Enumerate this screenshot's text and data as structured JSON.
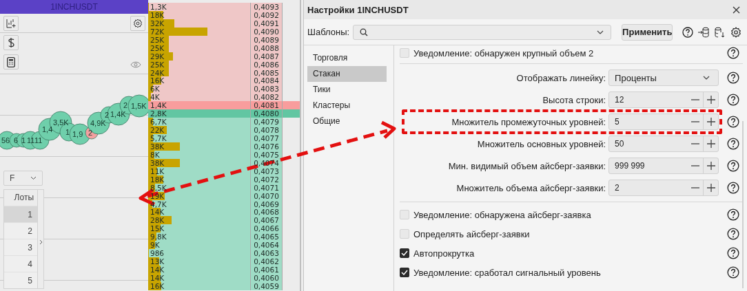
{
  "left_panel": {
    "header": "1INCHUSDT",
    "bubbles": [
      {
        "label": "56",
        "color": "#6fcfab"
      },
      {
        "label": "6",
        "color": "#6fcfab"
      },
      {
        "label": "1",
        "color": "#6fcfab"
      },
      {
        "label": "11",
        "color": "#6fcfab"
      },
      {
        "label": "11",
        "color": "#6fcfab"
      },
      {
        "label": "1,4",
        "color": "#6fcfab"
      },
      {
        "label": "3,5K",
        "color": "#6fcfab"
      },
      {
        "label": "1",
        "color": "#6fcfab"
      },
      {
        "label": "1,9",
        "color": "#6fcfab"
      },
      {
        "label": "2",
        "color": "#f4a0a0"
      },
      {
        "label": "4,9K",
        "color": "#6fcfab"
      },
      {
        "label": "2",
        "color": "#6fcfab"
      },
      {
        "label": "1,4K",
        "color": "#6fcfab"
      },
      {
        "label": "2",
        "color": "#6fcfab"
      },
      {
        "label": "1,5K",
        "color": "#6fcfab"
      }
    ],
    "dropdown": {
      "value": "F"
    },
    "lots_table": {
      "header": "Лоты",
      "rows": [
        {
          "value": "1",
          "selected": true
        },
        {
          "value": "2",
          "selected": false
        },
        {
          "value": "3",
          "selected": false
        },
        {
          "value": "4",
          "selected": false
        },
        {
          "value": "5",
          "selected": false
        }
      ]
    }
  },
  "order_book": [
    {
      "kind": "ask",
      "volume": "1,3K",
      "price": "0,4093",
      "level": 0.01
    },
    {
      "kind": "ask",
      "volume": "18K",
      "price": "0,4092",
      "level": 0.15
    },
    {
      "kind": "ask",
      "volume": "32K",
      "price": "0,4091",
      "level": 0.26
    },
    {
      "kind": "ask",
      "volume": "72K",
      "price": "0,4090",
      "level": 0.58
    },
    {
      "kind": "ask",
      "volume": "25K",
      "price": "0,4089",
      "level": 0.2
    },
    {
      "kind": "ask",
      "volume": "25K",
      "price": "0,4088",
      "level": 0.2
    },
    {
      "kind": "ask",
      "volume": "29K",
      "price": "0,4087",
      "level": 0.24
    },
    {
      "kind": "ask",
      "volume": "25K",
      "price": "0,4086",
      "level": 0.2
    },
    {
      "kind": "ask",
      "volume": "24K",
      "price": "0,4085",
      "level": 0.2
    },
    {
      "kind": "ask",
      "volume": "16K",
      "price": "0,4084",
      "level": 0.13
    },
    {
      "kind": "ask",
      "volume": "6K",
      "price": "0,4083",
      "level": 0.05
    },
    {
      "kind": "ask",
      "volume": "4K",
      "price": "0,4082",
      "level": 0.03
    },
    {
      "kind": "best_ask",
      "volume": "1,4K",
      "price": "0,4081"
    },
    {
      "kind": "best_bid",
      "volume": "2,8K",
      "price": "0,4080"
    },
    {
      "kind": "bid",
      "volume": "6,7K",
      "price": "0,4079",
      "level": 0.05
    },
    {
      "kind": "bid",
      "volume": "22K",
      "price": "0,4078",
      "level": 0.18
    },
    {
      "kind": "bid",
      "volume": "5,7K",
      "price": "0,4077",
      "level": 0.05
    },
    {
      "kind": "bid",
      "volume": "38K",
      "price": "0,4076",
      "level": 0.31
    },
    {
      "kind": "bid",
      "volume": "8K",
      "price": "0,4075",
      "level": 0.06
    },
    {
      "kind": "bid",
      "volume": "38K",
      "price": "0,4074",
      "level": 0.31
    },
    {
      "kind": "bid",
      "volume": "11K",
      "price": "0,4073",
      "level": 0.09
    },
    {
      "kind": "bid",
      "volume": "18K",
      "price": "0,4072",
      "level": 0.15
    },
    {
      "kind": "bid",
      "volume": "8,5K",
      "price": "0,4071",
      "level": 0.07
    },
    {
      "kind": "bid",
      "volume": "19K",
      "price": "0,4070",
      "level": 0.16
    },
    {
      "kind": "bid",
      "volume": "4,7K",
      "price": "0,4069",
      "level": 0.04
    },
    {
      "kind": "bid",
      "volume": "14K",
      "price": "0,4068",
      "level": 0.12
    },
    {
      "kind": "bid",
      "volume": "28K",
      "price": "0,4067",
      "level": 0.23
    },
    {
      "kind": "bid",
      "volume": "15K",
      "price": "0,4066",
      "level": 0.12
    },
    {
      "kind": "bid",
      "volume": "9,8K",
      "price": "0,4065",
      "level": 0.08
    },
    {
      "kind": "bid",
      "volume": "9K",
      "price": "0,4064",
      "level": 0.07
    },
    {
      "kind": "bid",
      "volume": "986",
      "price": "0,4063",
      "level": 0.01
    },
    {
      "kind": "bid",
      "volume": "13K",
      "price": "0,4062",
      "level": 0.11
    },
    {
      "kind": "bid",
      "volume": "14K",
      "price": "0,4061",
      "level": 0.12
    },
    {
      "kind": "bid",
      "volume": "14K",
      "price": "0,4060",
      "level": 0.12
    },
    {
      "kind": "bid",
      "volume": "16K",
      "price": "0,4059",
      "level": 0.13
    }
  ],
  "settings_dialog": {
    "title": "Настройки 1INCHUSDT",
    "templates_label": "Шаблоны:",
    "apply_button": "Применить",
    "nav": [
      {
        "label": "Торговля",
        "selected": false
      },
      {
        "label": "Стакан",
        "selected": true
      },
      {
        "label": "Тики",
        "selected": false
      },
      {
        "label": "Кластеры",
        "selected": false
      },
      {
        "label": "Общие",
        "selected": false
      }
    ],
    "top_option": {
      "label": "Уведомление: обнаружен крупный объем 2",
      "checked": false
    },
    "fields": [
      {
        "kind": "select",
        "label": "Отображать линейку:",
        "value": "Проценты",
        "highlighted": false
      },
      {
        "kind": "number",
        "label": "Высота строки:",
        "value": "12",
        "highlighted": false
      },
      {
        "kind": "number",
        "label": "Множитель промежуточных уровней:",
        "value": "5",
        "highlighted": true
      },
      {
        "kind": "number",
        "label": "Множитель основных уровней:",
        "value": "50",
        "highlighted": false
      },
      {
        "kind": "number",
        "label": "Мин. видимый объем айсберг-заявки:",
        "value": "999 999",
        "highlighted": false
      },
      {
        "kind": "number",
        "label": "Множитель объема айсберг-заявки:",
        "value": "2",
        "highlighted": false
      }
    ],
    "options": [
      {
        "label": "Уведомление: обнаружена айсберг-заявка",
        "checked": false
      },
      {
        "label": "Определять айсберг-заявки",
        "checked": false
      },
      {
        "label": "Автопрокрутка",
        "checked": true
      },
      {
        "label": "Уведомление: сработал сигнальный уровень",
        "checked": true
      }
    ]
  }
}
